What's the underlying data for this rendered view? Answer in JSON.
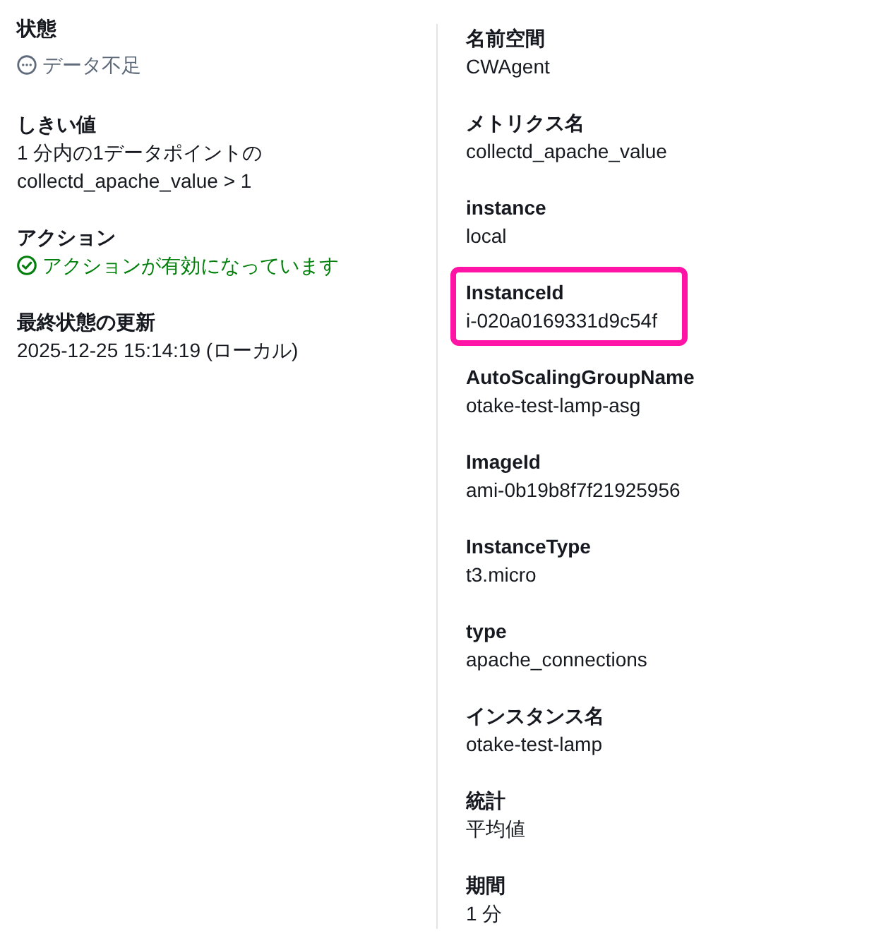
{
  "summary": [
    {
      "label": "状態",
      "kind": "pending",
      "lines": [
        "データ不足"
      ]
    },
    {
      "label": "しきい値",
      "kind": "text",
      "lines": [
        "1 分内の1データポイントの",
        "collectd_apache_value > 1"
      ]
    },
    {
      "label": "アクション",
      "kind": "success",
      "lines": [
        "アクションが有効になっています"
      ]
    },
    {
      "label": "最終状態の更新",
      "kind": "text",
      "lines": [
        "2025-12-25 15:14:19 (ローカル)"
      ]
    }
  ],
  "details": [
    {
      "label": "名前空間",
      "value": "CWAgent",
      "highlighted": false
    },
    {
      "label": "メトリクス名",
      "value": "collectd_apache_value",
      "highlighted": false
    },
    {
      "label": "instance",
      "value": "local",
      "highlighted": false
    },
    {
      "label": "InstanceId",
      "value": "i-020a0169331d9c54f",
      "highlighted": true
    },
    {
      "label": "AutoScalingGroupName",
      "value": "otake-test-lamp-asg",
      "highlighted": false
    },
    {
      "label": "ImageId",
      "value": "ami-0b19b8f7f21925956",
      "highlighted": false
    },
    {
      "label": "InstanceType",
      "value": "t3.micro",
      "highlighted": false
    },
    {
      "label": "type",
      "value": "apache_connections",
      "highlighted": false
    },
    {
      "label": "インスタンス名",
      "value": "otake-test-lamp",
      "highlighted": false
    },
    {
      "label": "統計",
      "value": "平均値",
      "highlighted": false
    },
    {
      "label": "期間",
      "value": "1 分",
      "highlighted": false
    }
  ]
}
